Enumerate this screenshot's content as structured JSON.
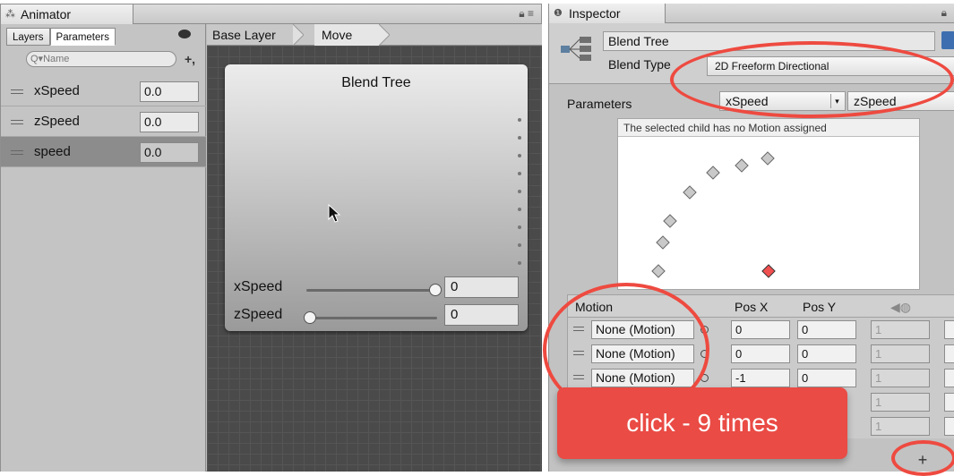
{
  "animator": {
    "title": "Animator",
    "tabs": [
      "Layers",
      "Parameters"
    ],
    "search_placeholder": "Q▾Name",
    "parameters": [
      {
        "name": "xSpeed",
        "value": "0.0"
      },
      {
        "name": "zSpeed",
        "value": "0.0"
      },
      {
        "name": "speed",
        "value": "0.0"
      }
    ],
    "breadcrumb": [
      "Base Layer",
      "Move"
    ],
    "node": {
      "title": "Blend Tree",
      "sliders": [
        {
          "label": "xSpeed",
          "value": "0",
          "position": 1.0
        },
        {
          "label": "zSpeed",
          "value": "0",
          "position": 0.0
        }
      ]
    }
  },
  "inspector": {
    "title": "Inspector",
    "name": "Blend Tree",
    "blend_type_label": "Blend Type",
    "blend_type_value": "2D Freeform Directional",
    "parameters_label": "Parameters",
    "param_x": "xSpeed",
    "param_y": "zSpeed",
    "message": "The selected child has no Motion assigned",
    "motion_headers": [
      "Motion",
      "Pos X",
      "Pos Y"
    ],
    "motions": [
      {
        "motion": "None (Motion)",
        "pos_x": "0",
        "pos_y": "0",
        "speed": "1"
      },
      {
        "motion": "None (Motion)",
        "pos_x": "0",
        "pos_y": "0",
        "speed": "1"
      },
      {
        "motion": "None (Motion)",
        "pos_x": "-1",
        "pos_y": "0",
        "speed": "1"
      },
      {
        "motion": "",
        "pos_x": "",
        "pos_y": "",
        "speed": "1"
      },
      {
        "motion": "",
        "pos_x": "",
        "pos_y": "",
        "speed": "1"
      }
    ],
    "add_button": "+"
  },
  "annotation": {
    "callout": "click - 9 times",
    "color": "#ea4b45"
  }
}
